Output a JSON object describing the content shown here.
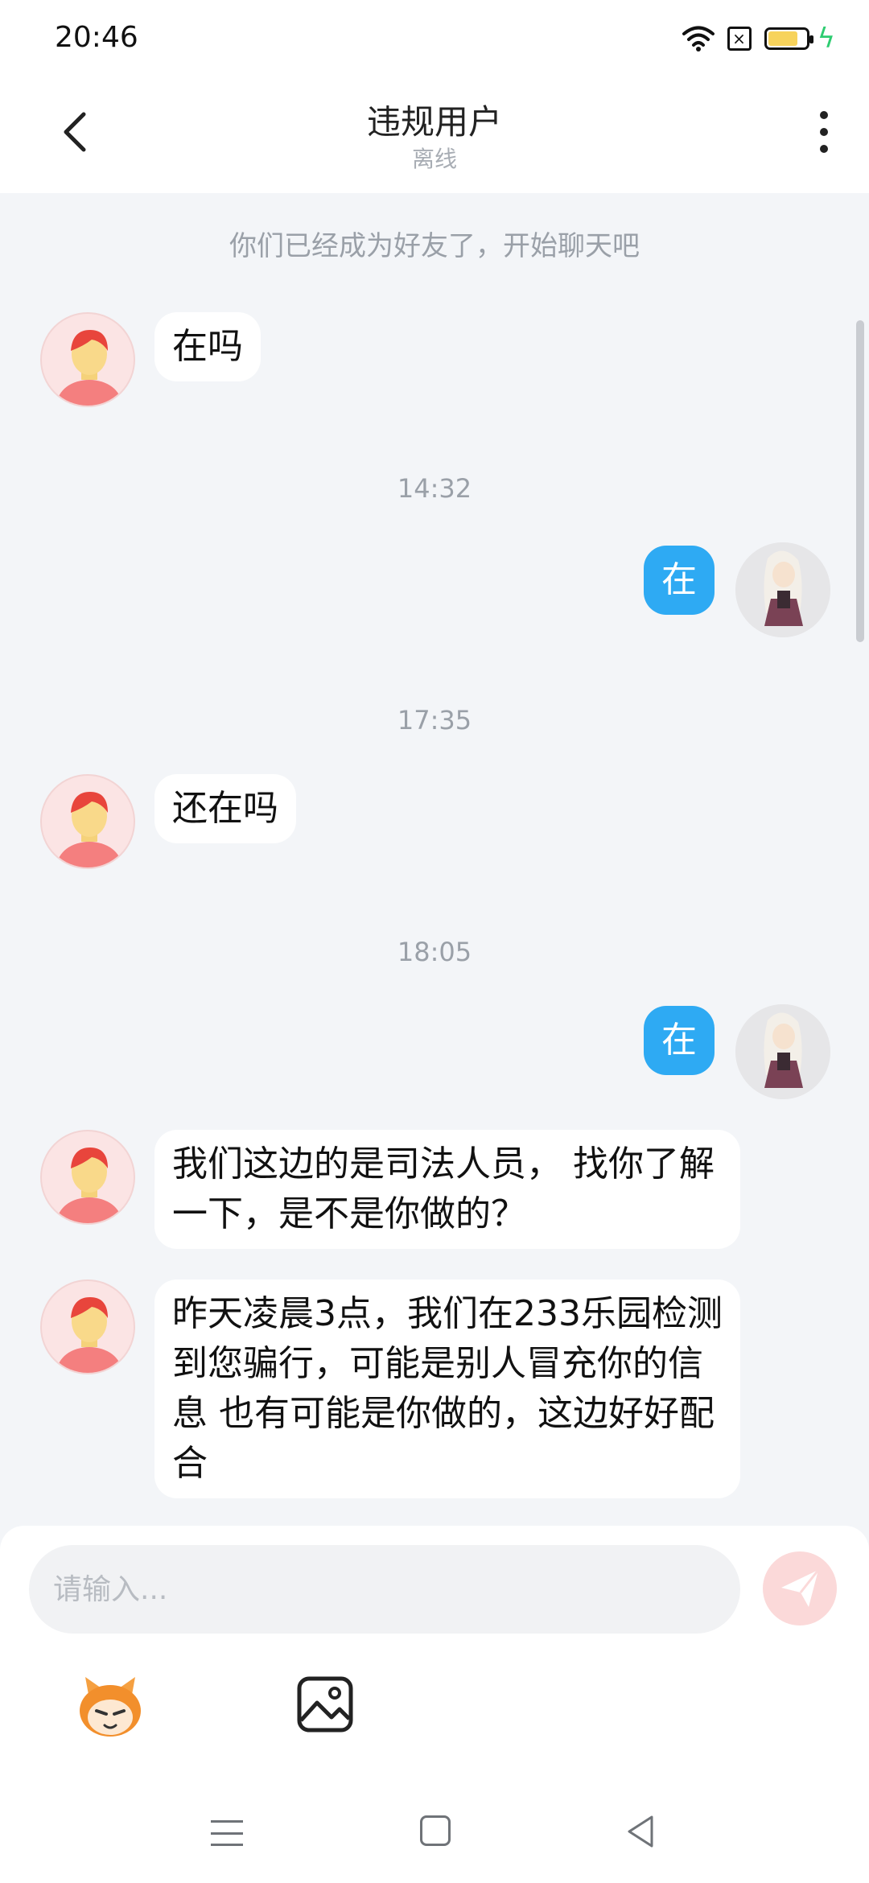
{
  "status_bar": {
    "time": "20:46",
    "icons": [
      "wifi-icon",
      "sim-disabled-icon",
      "battery-icon",
      "charging-icon"
    ],
    "battery_level": 0.8
  },
  "header": {
    "title": "违规用户",
    "subtitle": "离线",
    "icons": [
      "chevron-left-icon",
      "more-vertical-icon"
    ]
  },
  "chat": {
    "system_message": "你们已经成为好友了，开始聊天吧",
    "messages": [
      {
        "side": "left",
        "text": "在吗"
      },
      {
        "type": "time",
        "text": "14:32"
      },
      {
        "side": "right",
        "text": "在"
      },
      {
        "type": "time",
        "text": "17:35"
      },
      {
        "side": "left",
        "text": "还在吗"
      },
      {
        "type": "time",
        "text": "18:05"
      },
      {
        "side": "right",
        "text": "在"
      },
      {
        "side": "left",
        "text": "我们这边的是司法人员， 找你了解一下，是不是你做的？"
      },
      {
        "side": "left",
        "text": "昨天凌晨3点，我们在233乐园检测到您骗行，可能是别人冒充你的信息 也有可能是你做的，这边好好配合"
      }
    ]
  },
  "input": {
    "placeholder": "请输入...",
    "value": "",
    "icons": [
      "send-icon",
      "emoji-icon",
      "image-icon"
    ]
  },
  "navigation": {
    "icons": [
      "menu-icon",
      "home-icon",
      "back-triangle-icon"
    ]
  },
  "colors": {
    "accent_blue": "#2eaaf3",
    "background": "#f3f5f8",
    "send_button": "#fbd9d9",
    "charging": "#2ecc71",
    "battery": "#f7d35c"
  }
}
